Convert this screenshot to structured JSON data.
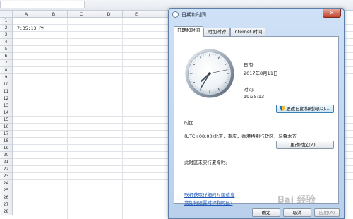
{
  "sheet": {
    "columns": [
      "A",
      "B",
      "C",
      "D",
      "E"
    ],
    "rows": [
      "1",
      "2",
      "3",
      "4",
      "5",
      "6",
      "7",
      "8",
      "9",
      "10",
      "11",
      "12",
      "13",
      "14",
      "15",
      "16",
      "17",
      "18",
      "19",
      "20",
      "21",
      "22",
      "23",
      "24",
      "25",
      "26",
      "27",
      "28"
    ],
    "cell_a2": "7:35:13 PM"
  },
  "dialog": {
    "title": "日期和时间",
    "close_label": "✕",
    "tabs": [
      "日期和时间",
      "附加时钟",
      "Internet 时间"
    ],
    "active_tab": 0,
    "date_label": "日期:",
    "date_value": "2017年8月11日",
    "time_label": "时间:",
    "time_value": "19:35:13",
    "change_datetime_button": "更改日期和时间(D)...",
    "timezone_heading": "时区",
    "timezone_value": "(UTC+08:00)北京，重庆，香港特别行政区，乌鲁木齐",
    "change_timezone_button": "更改时区(Z)...",
    "dst_note": "此时区未实行夏令时。",
    "link_online_tz": "联机获取详细的时区信息",
    "link_how_to_set": "我如何设置时钟和时区?",
    "ok_button": "确定",
    "cancel_button": "取消",
    "apply_button": "应用(A)",
    "clock": {
      "hours": 7,
      "minutes": 35,
      "seconds": 13
    }
  },
  "watermark": "Bai 经验"
}
